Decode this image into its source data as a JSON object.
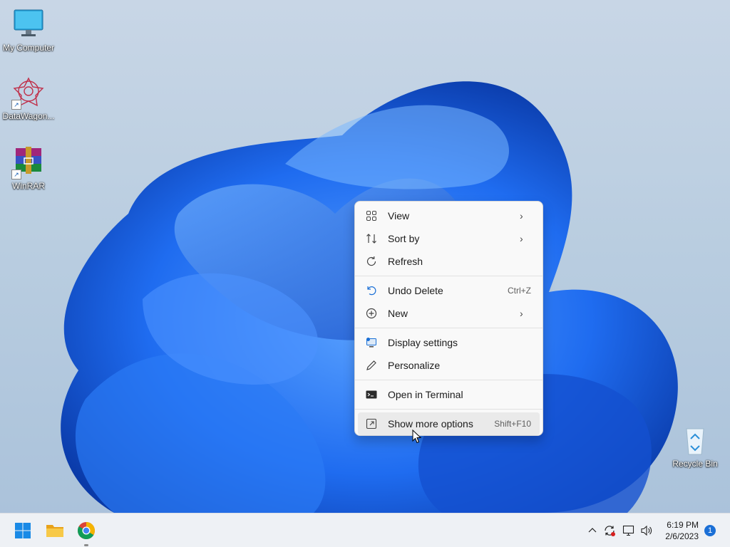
{
  "desktop": {
    "icons": [
      {
        "label": "My Computer",
        "icon": "monitor-icon"
      },
      {
        "label": "DataWagon...",
        "icon": "datawagon-icon"
      },
      {
        "label": "WinRAR",
        "icon": "winrar-icon"
      },
      {
        "label": "Recycle Bin",
        "icon": "recycle-bin-icon"
      }
    ]
  },
  "context_menu": {
    "items": [
      {
        "label": "View",
        "icon": "grid-view-icon",
        "submenu": true
      },
      {
        "label": "Sort by",
        "icon": "sort-icon",
        "submenu": true
      },
      {
        "label": "Refresh",
        "icon": "refresh-icon"
      },
      {
        "label": "Undo Delete",
        "icon": "undo-icon",
        "shortcut": "Ctrl+Z"
      },
      {
        "label": "New",
        "icon": "new-plus-icon",
        "submenu": true
      },
      {
        "label": "Display settings",
        "icon": "display-settings-icon"
      },
      {
        "label": "Personalize",
        "icon": "personalize-pen-icon"
      },
      {
        "label": "Open in Terminal",
        "icon": "terminal-icon"
      },
      {
        "label": "Show more options",
        "icon": "show-more-icon",
        "shortcut": "Shift+F10",
        "hovered": true
      }
    ]
  },
  "taskbar": {
    "apps": [
      "start-icon",
      "file-explorer-icon",
      "chrome-icon"
    ],
    "tray": [
      "chevron-up-icon",
      "sync-icon",
      "network-icon",
      "volume-icon"
    ],
    "time": "6:19 PM",
    "date": "2/6/2023",
    "notification_count": "1"
  },
  "colors": {
    "accent": "#1a6fd6",
    "bloom_dark": "#0b3fb0",
    "bloom_light": "#3f8cf5"
  }
}
